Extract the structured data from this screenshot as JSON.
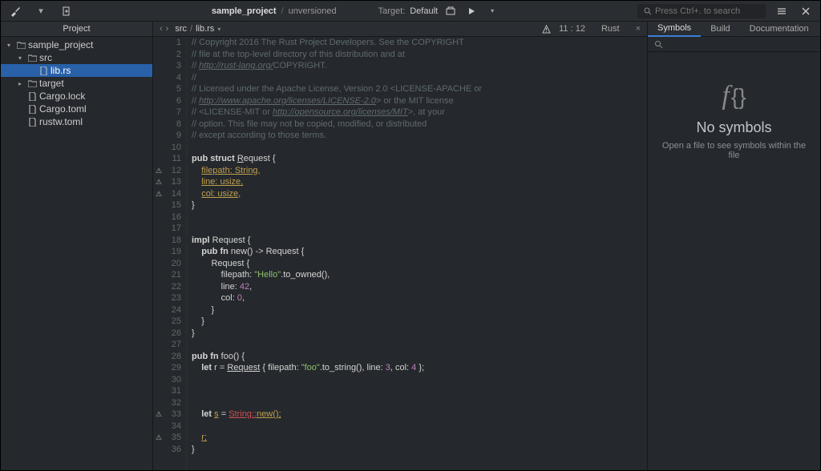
{
  "titlebar": {
    "project": "sample_project",
    "vcs": "unversioned",
    "target_label": "Target:",
    "target_value": "Default",
    "search_placeholder": "Press Ctrl+. to search"
  },
  "sidebar": {
    "header": "Project",
    "tree": [
      {
        "label": "sample_project",
        "kind": "folder",
        "open": true,
        "depth": 0
      },
      {
        "label": "src",
        "kind": "folder",
        "open": true,
        "depth": 1
      },
      {
        "label": "lib.rs",
        "kind": "file",
        "depth": 2,
        "selected": true
      },
      {
        "label": "target",
        "kind": "folder",
        "open": false,
        "depth": 1
      },
      {
        "label": "Cargo.lock",
        "kind": "file",
        "depth": 1
      },
      {
        "label": "Cargo.toml",
        "kind": "file",
        "depth": 1
      },
      {
        "label": "rustw.toml",
        "kind": "file",
        "depth": 1
      }
    ]
  },
  "tabbar": {
    "crumb1": "src",
    "crumb2": "lib.rs",
    "cursor": "11 : 12",
    "lang": "Rust"
  },
  "code": [
    {
      "n": 1,
      "w": "",
      "segs": [
        {
          "t": "// Copyright 2016 The Rust Project Developers. See the COPYRIGHT",
          "c": "c-comment"
        }
      ]
    },
    {
      "n": 2,
      "w": "",
      "segs": [
        {
          "t": "// file at the top-level directory of this distribution and at",
          "c": "c-comment"
        }
      ]
    },
    {
      "n": 3,
      "w": "",
      "segs": [
        {
          "t": "// ",
          "c": "c-comment"
        },
        {
          "t": "http://rust-lang.org/",
          "c": "c-link"
        },
        {
          "t": "COPYRIGHT.",
          "c": "c-comment"
        }
      ]
    },
    {
      "n": 4,
      "w": "",
      "segs": [
        {
          "t": "//",
          "c": "c-comment"
        }
      ]
    },
    {
      "n": 5,
      "w": "",
      "segs": [
        {
          "t": "// Licensed under the Apache License, Version 2.0 <LICENSE-APACHE or",
          "c": "c-comment"
        }
      ]
    },
    {
      "n": 6,
      "w": "",
      "segs": [
        {
          "t": "// ",
          "c": "c-comment"
        },
        {
          "t": "http://www.apache.org/licenses/LICENSE-2.0",
          "c": "c-link"
        },
        {
          "t": "> or the MIT license",
          "c": "c-comment"
        }
      ]
    },
    {
      "n": 7,
      "w": "",
      "segs": [
        {
          "t": "// <LICENSE-MIT or ",
          "c": "c-comment"
        },
        {
          "t": "http://opensource.org/licenses/MIT",
          "c": "c-link"
        },
        {
          "t": ">, at your",
          "c": "c-comment"
        }
      ]
    },
    {
      "n": 8,
      "w": "",
      "segs": [
        {
          "t": "// option. This file may not be copied, modified, or distributed",
          "c": "c-comment"
        }
      ]
    },
    {
      "n": 9,
      "w": "",
      "segs": [
        {
          "t": "// except according to those terms.",
          "c": "c-comment"
        }
      ]
    },
    {
      "n": 10,
      "w": "",
      "segs": [
        {
          "t": " ",
          "c": ""
        }
      ]
    },
    {
      "n": 11,
      "w": "",
      "segs": [
        {
          "t": "pub struct ",
          "c": "c-kw"
        },
        {
          "t": "R",
          "c": "c-ident c-under"
        },
        {
          "t": "equest {",
          "c": "c-ident"
        }
      ]
    },
    {
      "n": 12,
      "w": "⚠",
      "segs": [
        {
          "t": "    ",
          "c": ""
        },
        {
          "t": "filepath: String,",
          "c": "c-warn"
        }
      ]
    },
    {
      "n": 13,
      "w": "⚠",
      "segs": [
        {
          "t": "    ",
          "c": ""
        },
        {
          "t": "line: ",
          "c": "c-warn"
        },
        {
          "t": "usize",
          "c": "c-warn"
        },
        {
          "t": ",",
          "c": "c-warn"
        }
      ]
    },
    {
      "n": 14,
      "w": "⚠",
      "segs": [
        {
          "t": "    ",
          "c": ""
        },
        {
          "t": "col: ",
          "c": "c-warn"
        },
        {
          "t": "usize",
          "c": "c-warn"
        },
        {
          "t": ",",
          "c": "c-warn"
        }
      ]
    },
    {
      "n": 15,
      "w": "",
      "segs": [
        {
          "t": "}",
          "c": "c-ident"
        }
      ]
    },
    {
      "n": 16,
      "w": "",
      "segs": [
        {
          "t": " ",
          "c": ""
        }
      ]
    },
    {
      "n": 17,
      "w": "",
      "segs": [
        {
          "t": " ",
          "c": ""
        }
      ]
    },
    {
      "n": 18,
      "w": "",
      "segs": [
        {
          "t": "impl ",
          "c": "c-kw"
        },
        {
          "t": "Request {",
          "c": "c-ident"
        }
      ]
    },
    {
      "n": 19,
      "w": "",
      "segs": [
        {
          "t": "    ",
          "c": ""
        },
        {
          "t": "pub fn ",
          "c": "c-kw"
        },
        {
          "t": "new() -> Request {",
          "c": "c-ident"
        }
      ]
    },
    {
      "n": 20,
      "w": "",
      "segs": [
        {
          "t": "        Request {",
          "c": "c-ident"
        }
      ]
    },
    {
      "n": 21,
      "w": "",
      "segs": [
        {
          "t": "            filepath: ",
          "c": "c-field"
        },
        {
          "t": "\"Hello\"",
          "c": "c-str"
        },
        {
          "t": ".to_owned(),",
          "c": "c-ident"
        }
      ]
    },
    {
      "n": 22,
      "w": "",
      "segs": [
        {
          "t": "            line: ",
          "c": "c-field"
        },
        {
          "t": "42",
          "c": "c-num"
        },
        {
          "t": ",",
          "c": "c-ident"
        }
      ]
    },
    {
      "n": 23,
      "w": "",
      "segs": [
        {
          "t": "            col: ",
          "c": "c-field"
        },
        {
          "t": "0",
          "c": "c-num"
        },
        {
          "t": ",",
          "c": "c-ident"
        }
      ]
    },
    {
      "n": 24,
      "w": "",
      "segs": [
        {
          "t": "        }",
          "c": "c-ident"
        }
      ]
    },
    {
      "n": 25,
      "w": "",
      "segs": [
        {
          "t": "    }",
          "c": "c-ident"
        }
      ]
    },
    {
      "n": 26,
      "w": "",
      "segs": [
        {
          "t": "}",
          "c": "c-ident"
        }
      ]
    },
    {
      "n": 27,
      "w": "",
      "segs": [
        {
          "t": " ",
          "c": ""
        }
      ]
    },
    {
      "n": 28,
      "w": "",
      "segs": [
        {
          "t": "pub fn ",
          "c": "c-kw"
        },
        {
          "t": "foo() {",
          "c": "c-ident"
        }
      ]
    },
    {
      "n": 29,
      "w": "",
      "segs": [
        {
          "t": "    ",
          "c": ""
        },
        {
          "t": "let ",
          "c": "c-kw"
        },
        {
          "t": "r = ",
          "c": "c-ident"
        },
        {
          "t": "Request",
          "c": "c-ident c-under"
        },
        {
          "t": " { filepath: ",
          "c": "c-ident"
        },
        {
          "t": "\"foo\"",
          "c": "c-str"
        },
        {
          "t": ".to_string(), line: ",
          "c": "c-ident"
        },
        {
          "t": "3",
          "c": "c-num"
        },
        {
          "t": ", col: ",
          "c": "c-ident"
        },
        {
          "t": "4",
          "c": "c-num"
        },
        {
          "t": " };",
          "c": "c-ident"
        }
      ]
    },
    {
      "n": 30,
      "w": "",
      "segs": [
        {
          "t": " ",
          "c": ""
        }
      ]
    },
    {
      "n": 31,
      "w": "",
      "segs": [
        {
          "t": " ",
          "c": ""
        }
      ]
    },
    {
      "n": 32,
      "w": "",
      "segs": [
        {
          "t": " ",
          "c": ""
        }
      ]
    },
    {
      "n": 33,
      "w": "⚠",
      "segs": [
        {
          "t": "    ",
          "c": ""
        },
        {
          "t": "let ",
          "c": "c-kw"
        },
        {
          "t": "s",
          "c": "c-warn"
        },
        {
          "t": " = ",
          "c": "c-ident"
        },
        {
          "t": "String::",
          "c": "c-err"
        },
        {
          "t": "new();",
          "c": "c-warn"
        }
      ]
    },
    {
      "n": 34,
      "w": "",
      "segs": [
        {
          "t": " ",
          "c": ""
        }
      ]
    },
    {
      "n": 35,
      "w": "⚠",
      "segs": [
        {
          "t": "    ",
          "c": ""
        },
        {
          "t": "r;",
          "c": "c-warn"
        }
      ]
    },
    {
      "n": 36,
      "w": "",
      "segs": [
        {
          "t": "}",
          "c": "c-ident"
        }
      ]
    }
  ],
  "rightpanel": {
    "tabs": [
      "Symbols",
      "Build",
      "Documentation"
    ],
    "active_tab": 0,
    "empty_title": "No symbols",
    "empty_sub": "Open a file to see symbols within the file"
  }
}
